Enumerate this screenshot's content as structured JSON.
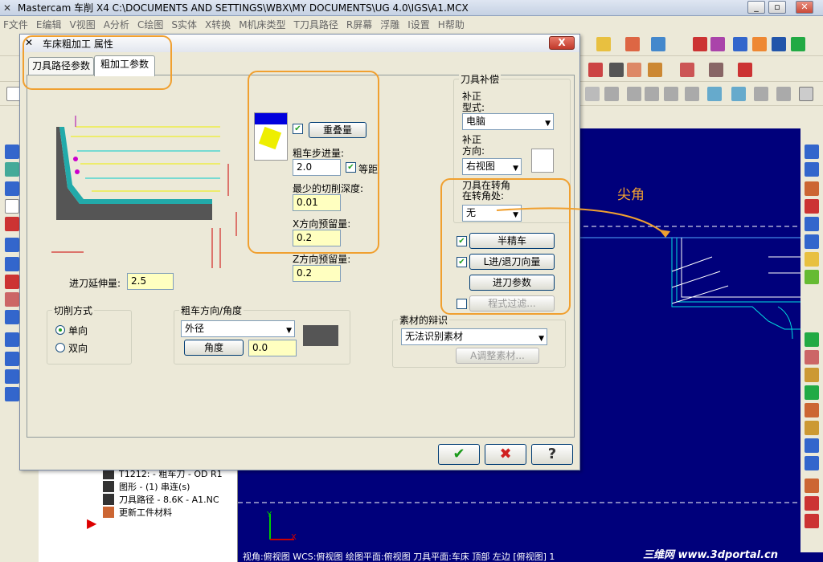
{
  "app": {
    "title": "Mastercam 车削  X4  C:\\DOCUMENTS AND SETTINGS\\WBX\\MY DOCUMENTS\\UG 4.0\\IGS\\A1.MCX",
    "menu": [
      "F文件",
      "E编辑",
      "V视图",
      "A分析",
      "C绘图",
      "S实体",
      "X转换",
      "M机床类型",
      "T刀具路径",
      "R屏幕",
      "浮雕",
      "I设置",
      "H帮助"
    ]
  },
  "dialog": {
    "title": "车床粗加工 属性",
    "close_label": "X",
    "tabs": [
      "刀具路径参数",
      "粗加工参数"
    ],
    "overlap_button": "重叠量",
    "overlap_checked": true,
    "step_label": "粗车步进量:",
    "step_value": "2.0",
    "equal_dist_label": "等距",
    "equal_dist_checked": true,
    "min_depth_label": "最少的切削深度:",
    "min_depth_value": "0.01",
    "x_stock_label": "X方向预留量:",
    "x_stock_value": "0.2",
    "z_stock_label": "Z方向预留量:",
    "z_stock_value": "0.2",
    "entry_ext_label": "进刀延伸量:",
    "entry_ext_value": "2.5",
    "cut_method": {
      "title": "切削方式",
      "options": [
        "单向",
        "双向"
      ],
      "selected": 0
    },
    "direction": {
      "title": "粗车方向/角度",
      "selected": "外径",
      "angle_button": "角度",
      "angle_value": "0.0"
    },
    "comp": {
      "title": "刀具补偿",
      "type_label": "补正\n型式:",
      "type_value": "电脑",
      "dir_label": "补正\n方向:",
      "dir_value": "右视图",
      "corner_label": "刀具在转角\n在转角处:",
      "corner_value": "无"
    },
    "semi_finish": {
      "label": "半精车",
      "checked": true
    },
    "lead_in_out": {
      "label": "L进/退刀向量",
      "checked": true
    },
    "plunge_label": "进刀参数",
    "filter": {
      "label": "程式过滤...",
      "checked": false
    },
    "stock": {
      "title": "素材的辩识",
      "selected": "无法识别素材",
      "adjust_label": "A调整素材..."
    },
    "ok": "✔",
    "cancel": "✖",
    "help": "?"
  },
  "annotation": {
    "corner_tip": "尖角"
  },
  "ops_tree": [
    "T1212: - 粗车刀 - OD R1",
    "图形 - (1) 串连(s)",
    "刀具路径 - 8.6K - A1.NC",
    "更新工件材料"
  ],
  "axes": {
    "y": "Y",
    "x": "X"
  },
  "status": "视角:俯视图   WCS:俯视图   绘图平面:俯视图   刀具平面:车床 顶部 左边 [俯视图] 1",
  "watermark": "三维网 www.3dportal.cn",
  "colors": {
    "viewport": "#00007b",
    "accent": "#f0a030",
    "tool_line": "#00e0e0"
  }
}
